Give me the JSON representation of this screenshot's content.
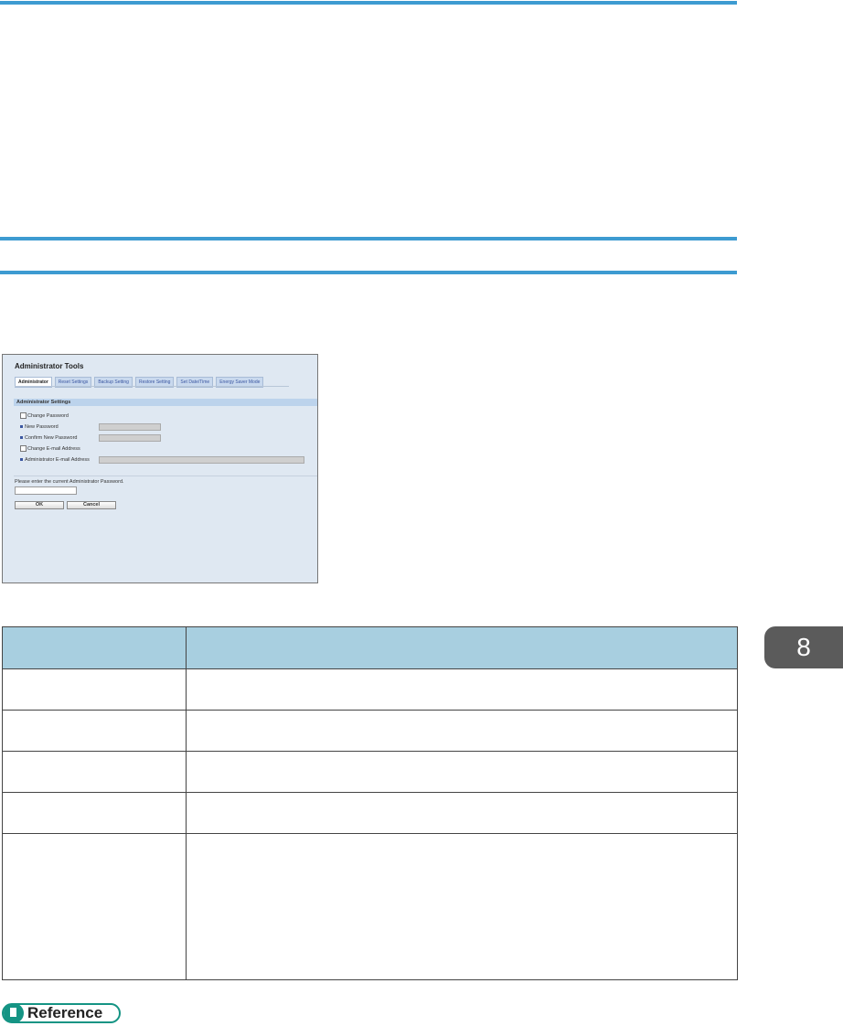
{
  "screenshot": {
    "title": "Administrator Tools",
    "tabs": [
      "Administrator",
      "Reset Settings",
      "Backup Setting",
      "Restore Setting",
      "Set Date/Time",
      "Energy Saver Mode"
    ],
    "section": "Administrator Settings",
    "change_password": "Change Password",
    "new_password": "New Password",
    "confirm_password": "Confirm New Password",
    "change_email": "Change E-mail Address",
    "admin_email": "Administrator E-mail Address",
    "prompt": "Please enter the current Administrator Password.",
    "ok": "OK",
    "cancel": "Cancel"
  },
  "chapter": "8",
  "reference": "Reference",
  "colors": {
    "rule": "#3d9bd1",
    "table_header": "#a8cfe0",
    "chapter_tab": "#5b5b5b",
    "reference": "#159484"
  }
}
